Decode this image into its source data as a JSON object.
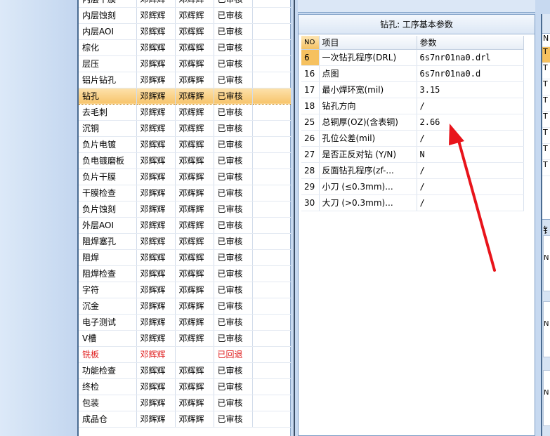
{
  "process_list": {
    "rows": [
      {
        "name": "内层干膜",
        "col2": "邓辉辉",
        "col3": "邓辉辉",
        "status": "已审核"
      },
      {
        "name": "内层蚀刻",
        "col2": "邓辉辉",
        "col3": "邓辉辉",
        "status": "已审核"
      },
      {
        "name": "内层AOI",
        "col2": "邓辉辉",
        "col3": "邓辉辉",
        "status": "已审核"
      },
      {
        "name": "棕化",
        "col2": "邓辉辉",
        "col3": "邓辉辉",
        "status": "已审核"
      },
      {
        "name": "层压",
        "col2": "邓辉辉",
        "col3": "邓辉辉",
        "status": "已审核"
      },
      {
        "name": "铝片钻孔",
        "col2": "邓辉辉",
        "col3": "邓辉辉",
        "status": "已审核"
      },
      {
        "name": "钻孔",
        "col2": "邓辉辉",
        "col3": "邓辉辉",
        "status": "已审核"
      },
      {
        "name": "去毛刺",
        "col2": "邓辉辉",
        "col3": "邓辉辉",
        "status": "已审核"
      },
      {
        "name": "沉铜",
        "col2": "邓辉辉",
        "col3": "邓辉辉",
        "status": "已审核"
      },
      {
        "name": "负片电镀",
        "col2": "邓辉辉",
        "col3": "邓辉辉",
        "status": "已审核"
      },
      {
        "name": "负电镀磨板",
        "col2": "邓辉辉",
        "col3": "邓辉辉",
        "status": "已审核"
      },
      {
        "name": "负片干膜",
        "col2": "邓辉辉",
        "col3": "邓辉辉",
        "status": "已审核"
      },
      {
        "name": "干膜检查",
        "col2": "邓辉辉",
        "col3": "邓辉辉",
        "status": "已审核"
      },
      {
        "name": "负片蚀刻",
        "col2": "邓辉辉",
        "col3": "邓辉辉",
        "status": "已审核"
      },
      {
        "name": "外层AOI",
        "col2": "邓辉辉",
        "col3": "邓辉辉",
        "status": "已审核"
      },
      {
        "name": "阻焊塞孔",
        "col2": "邓辉辉",
        "col3": "邓辉辉",
        "status": "已审核"
      },
      {
        "name": "阻焊",
        "col2": "邓辉辉",
        "col3": "邓辉辉",
        "status": "已审核"
      },
      {
        "name": "阻焊检查",
        "col2": "邓辉辉",
        "col3": "邓辉辉",
        "status": "已审核"
      },
      {
        "name": "字符",
        "col2": "邓辉辉",
        "col3": "邓辉辉",
        "status": "已审核"
      },
      {
        "name": "沉金",
        "col2": "邓辉辉",
        "col3": "邓辉辉",
        "status": "已审核"
      },
      {
        "name": "电子测试",
        "col2": "邓辉辉",
        "col3": "邓辉辉",
        "status": "已审核"
      },
      {
        "name": "V槽",
        "col2": "邓辉辉",
        "col3": "邓辉辉",
        "status": "已审核"
      },
      {
        "name": "铣板",
        "col2": "邓辉辉",
        "col3": "",
        "status": "已回退"
      },
      {
        "name": "功能检查",
        "col2": "邓辉辉",
        "col3": "邓辉辉",
        "status": "已审核"
      },
      {
        "name": "终检",
        "col2": "邓辉辉",
        "col3": "邓辉辉",
        "status": "已审核"
      },
      {
        "name": "包装",
        "col2": "邓辉辉",
        "col3": "邓辉辉",
        "status": "已审核"
      },
      {
        "name": "成品仓",
        "col2": "邓辉辉",
        "col3": "邓辉辉",
        "status": "已审核"
      }
    ],
    "selected_index": 6,
    "rejected_index": 22
  },
  "params": {
    "title": "钻孔: 工序基本参数",
    "headers": {
      "no": "NO",
      "item": "项目",
      "value": "参数"
    },
    "rows": [
      {
        "no": "6",
        "item": "一次钻孔程序(DRL)",
        "value": "6s7nr01na0.drl"
      },
      {
        "no": "16",
        "item": "点图",
        "value": "6s7nr01na0.d"
      },
      {
        "no": "17",
        "item": "最小焊环宽(mil)",
        "value": "3.15"
      },
      {
        "no": "18",
        "item": "钻孔方向",
        "value": "/"
      },
      {
        "no": "25",
        "item": "总铜厚(OZ)(含表铜)",
        "value": "2.66"
      },
      {
        "no": "26",
        "item": "孔位公差(mil)",
        "value": "/"
      },
      {
        "no": "27",
        "item": "是否正反对钻 (Y/N)",
        "value": "N"
      },
      {
        "no": "28",
        "item": "反面钻孔程序(zf-...",
        "value": "/"
      },
      {
        "no": "29",
        "item": "小刀 (≤0.3mm)...",
        "value": "/"
      },
      {
        "no": "30",
        "item": "大刀 (>0.3mm)...",
        "value": "/"
      }
    ]
  },
  "right_panel": {
    "header": "N",
    "cells": [
      "T",
      "T",
      "T",
      "T",
      "T",
      "T",
      "T",
      "T"
    ],
    "section_label": "钅",
    "box_labels": [
      "N",
      "N",
      "N"
    ]
  },
  "colors": {
    "selected_row": "#f7c46b",
    "rejected_text": "#e02020",
    "arrow": "#e8141b",
    "panel_border": "#7b9cc4"
  }
}
